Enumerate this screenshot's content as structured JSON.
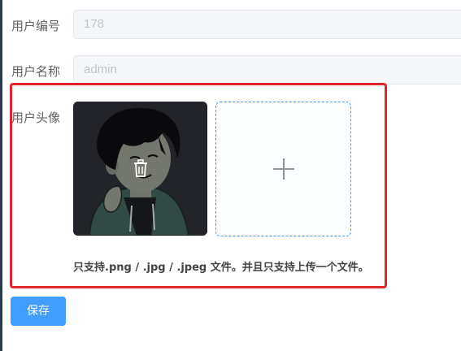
{
  "form": {
    "user_id_label": "用户编号",
    "user_id_value": "178",
    "user_name_label": "用户名称",
    "user_name_value": "admin",
    "avatar_label": "用户头像",
    "upload_tip": "只支持.png / .jpg / .jpeg 文件。并且只支持上传一个文件。",
    "save_label": "保存"
  },
  "icons": {
    "delete": "trash-icon",
    "add": "plus-icon"
  },
  "colors": {
    "primary": "#409eff",
    "highlight_border": "#e0262a",
    "avatar_bg": "#2a2c33"
  }
}
